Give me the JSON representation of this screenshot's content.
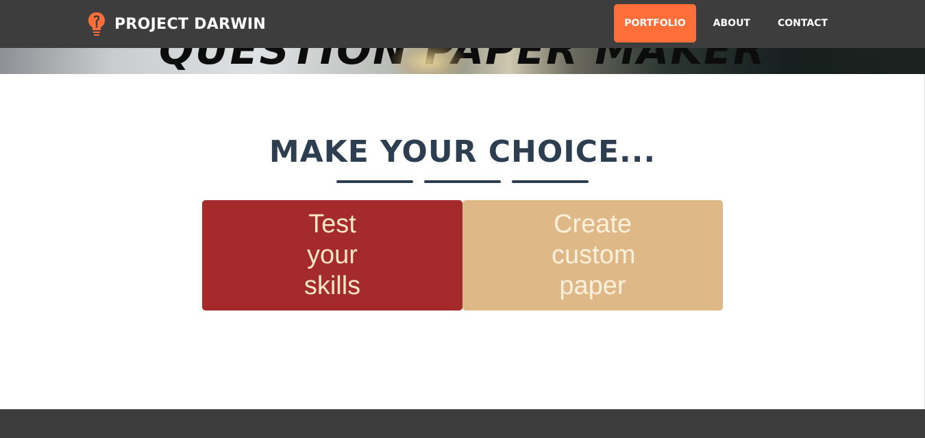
{
  "hero": {
    "title": "QUESTION PAPER MAKER"
  },
  "navbar": {
    "brand": "PROJECT DARWIN",
    "logo_icon": "lightbulb-logo-icon",
    "links": [
      {
        "label": "PORTFOLIO",
        "active": true
      },
      {
        "label": "ABOUT",
        "active": false
      },
      {
        "label": "CONTACT",
        "active": false
      }
    ]
  },
  "main": {
    "heading": "MAKE YOUR CHOICE...",
    "choices": [
      {
        "label": "Test your skills",
        "color": "#a42a2b"
      },
      {
        "label": "Create custom paper",
        "color": "#dfb887"
      }
    ]
  },
  "colors": {
    "nav_bg": "#3d3d3d",
    "accent": "#fd6e39",
    "heading": "#2c3e50"
  }
}
